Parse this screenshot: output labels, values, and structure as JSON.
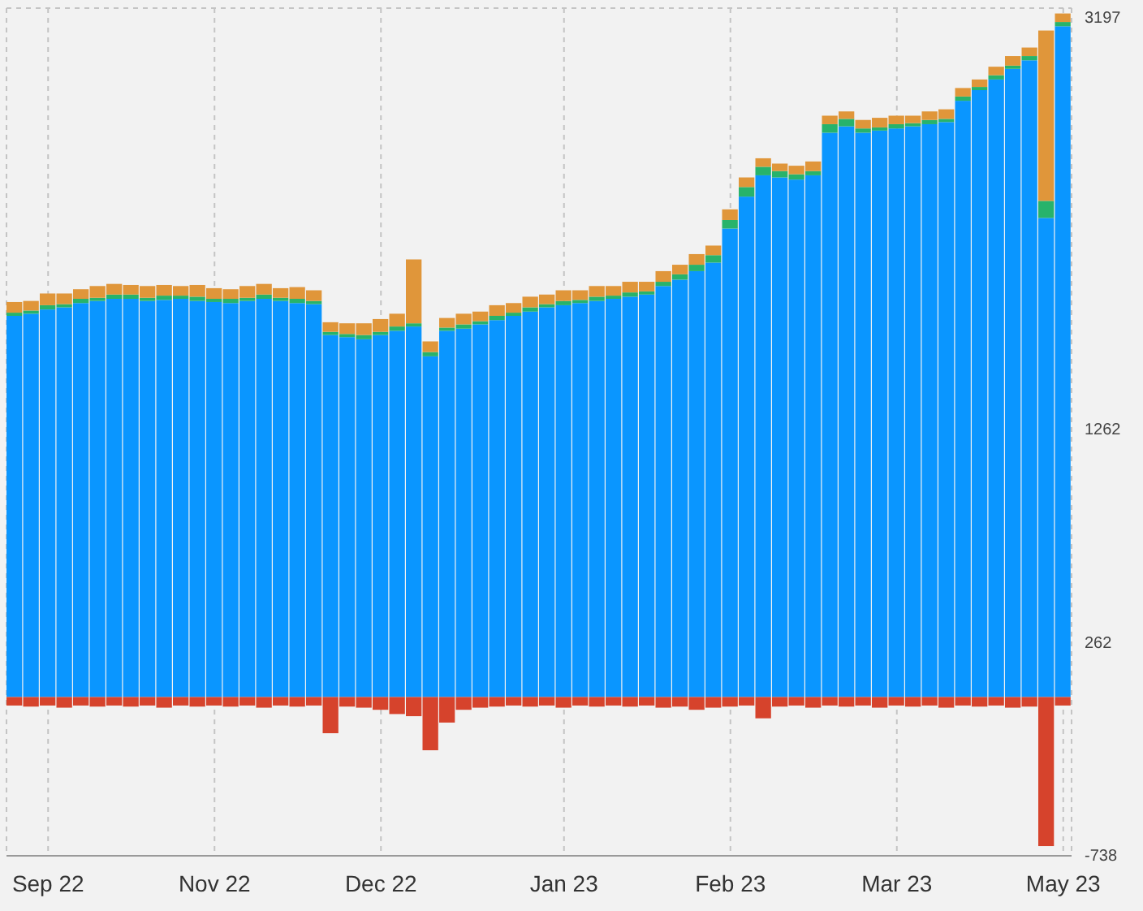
{
  "chart_data": {
    "type": "bar",
    "stacked": true,
    "grid": true,
    "ylim": [
      -738,
      3197
    ],
    "yticks": [
      -738,
      262,
      1262,
      3197
    ],
    "categories": [
      null,
      null,
      "Sep 22",
      null,
      null,
      null,
      null,
      null,
      null,
      null,
      null,
      null,
      "Nov 22",
      null,
      null,
      null,
      null,
      null,
      null,
      null,
      null,
      null,
      "Dec 22",
      null,
      null,
      null,
      null,
      null,
      null,
      null,
      null,
      null,
      null,
      "Jan 23",
      null,
      null,
      null,
      null,
      null,
      null,
      null,
      null,
      null,
      "Feb 23",
      null,
      null,
      null,
      null,
      null,
      null,
      null,
      null,
      null,
      "Mar 23",
      null,
      null,
      null,
      null,
      null,
      null,
      null,
      null,
      null,
      "May 23"
    ],
    "series": [
      {
        "color": "#0a96ff",
        "values": [
          1790,
          1800,
          1820,
          1830,
          1850,
          1860,
          1870,
          1870,
          1860,
          1865,
          1870,
          1860,
          1855,
          1850,
          1860,
          1870,
          1860,
          1850,
          1845,
          1700,
          1690,
          1680,
          1700,
          1720,
          1740,
          1600,
          1720,
          1730,
          1750,
          1770,
          1790,
          1810,
          1830,
          1840,
          1850,
          1860,
          1870,
          1880,
          1890,
          1930,
          1960,
          2000,
          2040,
          2200,
          2350,
          2450,
          2440,
          2430,
          2450,
          2650,
          2680,
          2650,
          2660,
          2670,
          2680,
          2690,
          2700,
          2800,
          2850,
          2900,
          2950,
          2990,
          2250,
          3150
        ]
      },
      {
        "color": "#27b36b",
        "values": [
          15,
          15,
          20,
          15,
          20,
          15,
          20,
          20,
          15,
          20,
          15,
          20,
          15,
          20,
          15,
          20,
          15,
          20,
          15,
          15,
          15,
          20,
          15,
          20,
          15,
          20,
          15,
          20,
          15,
          20,
          15,
          20,
          15,
          20,
          15,
          20,
          15,
          20,
          15,
          20,
          25,
          30,
          35,
          40,
          45,
          40,
          30,
          25,
          20,
          40,
          35,
          20,
          15,
          20,
          15,
          20,
          15,
          20,
          15,
          20,
          15,
          20,
          80,
          20
        ]
      },
      {
        "color": "#e0963a",
        "values": [
          50,
          45,
          55,
          50,
          45,
          55,
          50,
          45,
          55,
          50,
          45,
          55,
          50,
          45,
          55,
          50,
          45,
          55,
          50,
          45,
          50,
          55,
          60,
          60,
          300,
          50,
          45,
          50,
          45,
          50,
          45,
          50,
          45,
          50,
          45,
          50,
          45,
          50,
          45,
          50,
          45,
          50,
          45,
          50,
          45,
          40,
          35,
          40,
          45,
          40,
          35,
          40,
          45,
          40,
          35,
          40,
          45,
          40,
          35,
          40,
          45,
          40,
          800,
          40
        ]
      },
      {
        "color": "#d6432c",
        "values": [
          -40,
          -45,
          -40,
          -50,
          -40,
          -45,
          -40,
          -45,
          -40,
          -50,
          -40,
          -45,
          -40,
          -45,
          -40,
          -50,
          -40,
          -45,
          -40,
          -170,
          -45,
          -50,
          -60,
          -80,
          -90,
          -250,
          -120,
          -60,
          -50,
          -45,
          -40,
          -45,
          -40,
          -50,
          -40,
          -45,
          -40,
          -45,
          -40,
          -50,
          -45,
          -60,
          -50,
          -45,
          -40,
          -100,
          -45,
          -40,
          -50,
          -40,
          -45,
          -40,
          -50,
          -40,
          -45,
          -40,
          -50,
          -40,
          -45,
          -40,
          -50,
          -45,
          -700,
          -40
        ]
      }
    ]
  }
}
